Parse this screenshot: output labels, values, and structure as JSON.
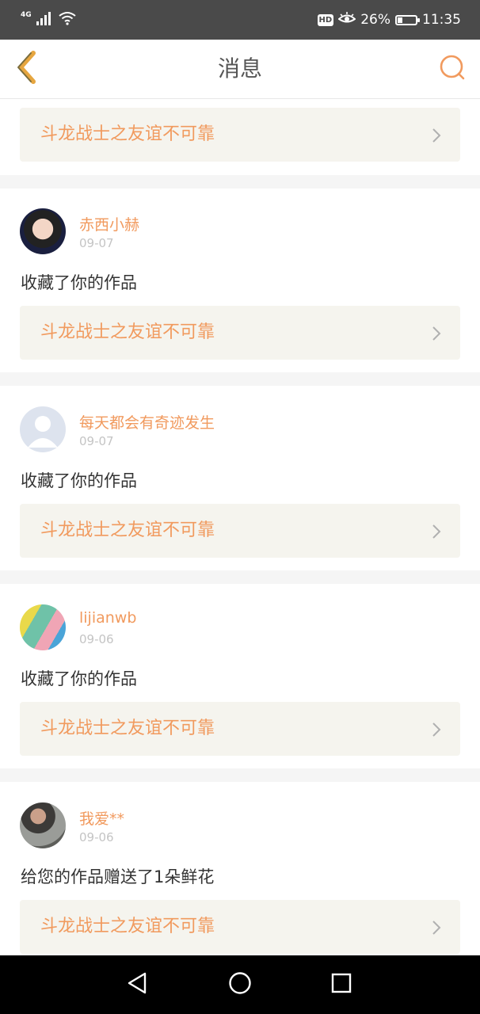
{
  "status_bar": {
    "network": "4G",
    "hd_badge": "HD",
    "battery_percent": "26%",
    "battery_level": 0.26,
    "time": "11:35"
  },
  "header": {
    "title": "消息",
    "back_icon": "chevron-left-icon",
    "search_icon": "search-icon"
  },
  "colors": {
    "accent": "#f19a5e",
    "card_bg": "#f5f4ee",
    "separator": "#f5f5f5",
    "status_bar_bg": "#4a4a4a"
  },
  "top_card": {
    "work_title": "斗龙战士之友谊不可靠"
  },
  "messages": [
    {
      "username": "赤西小赫",
      "date": "09-07",
      "action": "收藏了你的作品",
      "work_title": "斗龙战士之友谊不可靠"
    },
    {
      "username": "每天都会有奇迹发生",
      "date": "09-07",
      "action": "收藏了你的作品",
      "work_title": "斗龙战士之友谊不可靠"
    },
    {
      "username": "lijianwb",
      "date": "09-06",
      "action": "收藏了你的作品",
      "work_title": "斗龙战士之友谊不可靠"
    },
    {
      "username": "我爱**",
      "date": "09-06",
      "action": "给您的作品赠送了1朵鲜花",
      "work_title": "斗龙战士之友谊不可靠"
    }
  ],
  "nav_bar": {
    "back_icon": "triangle-back-icon",
    "home_icon": "circle-home-icon",
    "recents_icon": "square-recents-icon"
  }
}
